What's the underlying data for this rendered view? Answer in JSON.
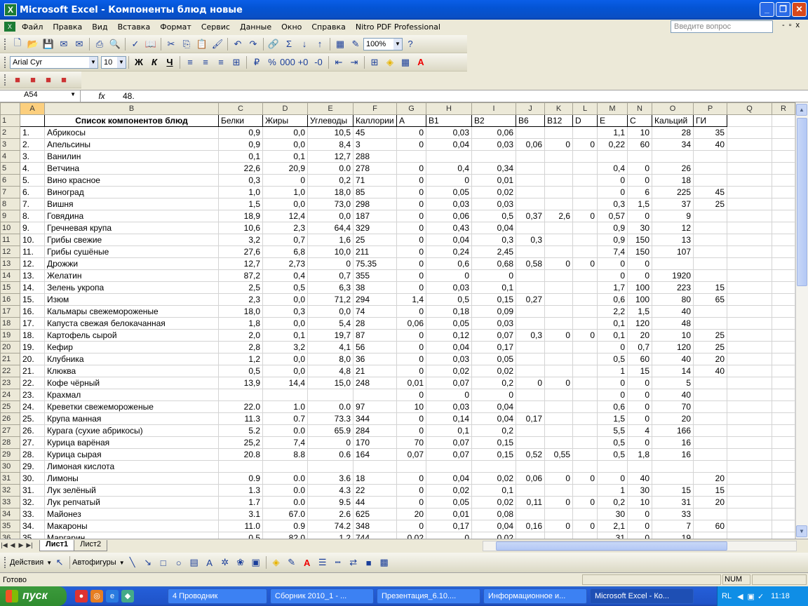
{
  "app": {
    "title": "Microsoft Excel - Компоненты блюд новые"
  },
  "menu": {
    "items": [
      "Файл",
      "Правка",
      "Вид",
      "Вставка",
      "Формат",
      "Сервис",
      "Данные",
      "Окно",
      "Справка",
      "Nitro PDF Professional"
    ],
    "help_placeholder": "Введите вопрос"
  },
  "toolbar": {
    "zoom": "100%",
    "font": "Arial Cyr",
    "size": "10",
    "bold": "Ж",
    "italic": "К",
    "underline": "Ч"
  },
  "formula": {
    "cell": "A54",
    "fx": "fx",
    "value": "48."
  },
  "columns": [
    "A",
    "B",
    "C",
    "D",
    "E",
    "F",
    "G",
    "H",
    "I",
    "J",
    "K",
    "L",
    "M",
    "N",
    "O",
    "P",
    "Q",
    "R"
  ],
  "header": [
    "",
    "Список компонентов блюд",
    "Белки",
    "Жиры",
    "Углеводы",
    "Каллории",
    "A",
    "B1",
    "B2",
    "B6",
    "B12",
    "D",
    "E",
    "C",
    "Кальций",
    "ГИ"
  ],
  "rows": [
    [
      "1.",
      "Абрикосы",
      "0,9",
      "0,0",
      "10,5",
      "45",
      "0",
      "0,03",
      "0,06",
      "",
      "",
      "",
      "1,1",
      "10",
      "28",
      "35"
    ],
    [
      "2.",
      "Апельсины",
      "0,9",
      "0,0",
      "8,4",
      "3",
      "0",
      "0,04",
      "0,03",
      "0,06",
      "0",
      "0",
      "0,22",
      "60",
      "34",
      "40"
    ],
    [
      "3.",
      "Ванилин",
      "0,1",
      "0,1",
      "12,7",
      "288",
      "",
      "",
      "",
      "",
      "",
      "",
      "",
      "",
      "",
      ""
    ],
    [
      "4.",
      "Ветчина",
      "22,6",
      "20,9",
      "0.0",
      "278",
      "0",
      "0,4",
      "0,34",
      "",
      "",
      "",
      "0,4",
      "0",
      "26",
      ""
    ],
    [
      "5.",
      "Вино красное",
      "0,3",
      "0",
      "0,2",
      "71",
      "0",
      "0",
      "0,01",
      "",
      "",
      "",
      "0",
      "0",
      "18",
      ""
    ],
    [
      "6.",
      "Виноград",
      "1,0",
      "1,0",
      "18,0",
      "85",
      "0",
      "0,05",
      "0,02",
      "",
      "",
      "",
      "0",
      "6",
      "225",
      "45"
    ],
    [
      "7.",
      "Вишня",
      "1,5",
      "0,0",
      "73,0",
      "298",
      "0",
      "0,03",
      "0,03",
      "",
      "",
      "",
      "0,3",
      "1,5",
      "37",
      "25"
    ],
    [
      "8.",
      "Говядина",
      "18,9",
      "12,4",
      "0,0",
      "187",
      "0",
      "0,06",
      "0,5",
      "0,37",
      "2,6",
      "0",
      "0,57",
      "0",
      "9",
      ""
    ],
    [
      "9.",
      "Гречневая крупа",
      "10,6",
      "2,3",
      "64,4",
      "329",
      "0",
      "0,43",
      "0,04",
      "",
      "",
      "",
      "0,9",
      "30",
      "12",
      ""
    ],
    [
      "10.",
      "Грибы свежие",
      "3,2",
      "0,7",
      "1,6",
      "25",
      "0",
      "0,04",
      "0,3",
      "0,3",
      "",
      "",
      "0,9",
      "150",
      "13",
      ""
    ],
    [
      "11.",
      "Грибы сушёные",
      "27,6",
      "6,8",
      "10,0",
      "211",
      "0",
      "0,24",
      "2,45",
      "",
      "",
      "",
      "7,4",
      "150",
      "107",
      ""
    ],
    [
      "12.",
      "Дрожжи",
      "12,7",
      "2,73",
      "0",
      "75.35",
      "0",
      "0,6",
      "0,68",
      "0,58",
      "0",
      "0",
      "0",
      "0",
      "",
      ""
    ],
    [
      "13.",
      "Желатин",
      "87,2",
      "0,4",
      "0,7",
      "355",
      "0",
      "0",
      "0",
      "",
      "",
      "",
      "0",
      "0",
      "1920",
      ""
    ],
    [
      "14.",
      "Зелень укропа",
      "2,5",
      "0,5",
      "6,3",
      "38",
      "0",
      "0,03",
      "0,1",
      "",
      "",
      "",
      "1,7",
      "100",
      "223",
      "15"
    ],
    [
      "15.",
      "Изюм",
      "2,3",
      "0,0",
      "71,2",
      "294",
      "1,4",
      "0,5",
      "0,15",
      "0,27",
      "",
      "",
      "0,6",
      "100",
      "80",
      "65"
    ],
    [
      "16.",
      "Кальмары свежемороженые",
      "18,0",
      "0,3",
      "0,0",
      "74",
      "0",
      "0,18",
      "0,09",
      "",
      "",
      "",
      "2,2",
      "1,5",
      "40",
      ""
    ],
    [
      "17.",
      "Капуста свежая белокачанная",
      "1,8",
      "0,0",
      "5,4",
      "28",
      "0,06",
      "0,05",
      "0,03",
      "",
      "",
      "",
      "0,1",
      "120",
      "48",
      ""
    ],
    [
      "18.",
      "Картофель сырой",
      "2,0",
      "0,1",
      "19,7",
      "87",
      "0",
      "0,12",
      "0,07",
      "0,3",
      "0",
      "0",
      "0,1",
      "20",
      "10",
      "25"
    ],
    [
      "19.",
      "Кефир",
      "2,8",
      "3,2",
      "4,1",
      "56",
      "0",
      "0,04",
      "0,17",
      "",
      "",
      "",
      "0",
      "0,7",
      "120",
      "25"
    ],
    [
      "20.",
      "Клубника",
      "1,2",
      "0,0",
      "8,0",
      "36",
      "0",
      "0,03",
      "0,05",
      "",
      "",
      "",
      "0,5",
      "60",
      "40",
      "20"
    ],
    [
      "21.",
      "Клюква",
      "0,5",
      "0,0",
      "4,8",
      "21",
      "0",
      "0,02",
      "0,02",
      "",
      "",
      "",
      "1",
      "15",
      "14",
      "40"
    ],
    [
      "22.",
      "Кофе чёрный",
      "13,9",
      "14,4",
      "15,0",
      "248",
      "0,01",
      "0,07",
      "0,2",
      "0",
      "0",
      "",
      "0",
      "0",
      "5",
      ""
    ],
    [
      "23.",
      "Крахмал",
      "",
      "",
      "",
      "",
      "0",
      "0",
      "0",
      "",
      "",
      "",
      "0",
      "0",
      "40",
      ""
    ],
    [
      "24.",
      "Креветки свежемороженые",
      "22.0",
      "1.0",
      "0.0",
      "97",
      "10",
      "0,03",
      "0,04",
      "",
      "",
      "",
      "0,6",
      "0",
      "70",
      ""
    ],
    [
      "25.",
      "Крупа манная",
      "11.3",
      "0.7",
      "73.3",
      "344",
      "0",
      "0,14",
      "0,04",
      "0,17",
      "",
      "",
      "1,5",
      "0",
      "20",
      ""
    ],
    [
      "26.",
      "Курага (сухие абрикосы)",
      "5.2",
      "0.0",
      "65.9",
      "284",
      "0",
      "0,1",
      "0,2",
      "",
      "",
      "",
      "5,5",
      "4",
      "166",
      ""
    ],
    [
      "27.",
      "Курица варёная",
      "25,2",
      "7,4",
      "0",
      "170",
      "70",
      "0,07",
      "0,15",
      "",
      "",
      "",
      "0,5",
      "0",
      "16",
      ""
    ],
    [
      "28.",
      "Курица сырая",
      "20.8",
      "8.8",
      "0.6",
      "164",
      "0,07",
      "0,07",
      "0,15",
      "0,52",
      "0,55",
      "",
      "0,5",
      "1,8",
      "16",
      ""
    ],
    [
      "29.",
      "Лимоная кислота",
      "",
      "",
      "",
      "",
      "",
      "",
      "",
      "",
      "",
      "",
      "",
      "",
      "",
      ""
    ],
    [
      "30.",
      "Лимоны",
      "0.9",
      "0.0",
      "3.6",
      "18",
      "0",
      "0,04",
      "0,02",
      "0,06",
      "0",
      "0",
      "0",
      "40",
      "",
      "20"
    ],
    [
      "31.",
      "Лук зелёный",
      "1.3",
      "0.0",
      "4.3",
      "22",
      "0",
      "0,02",
      "0,1",
      "",
      "",
      "",
      "1",
      "30",
      "15",
      "15"
    ],
    [
      "32.",
      "Лук репчатый",
      "1.7",
      "0.0",
      "9.5",
      "44",
      "0",
      "0,05",
      "0,02",
      "0,11",
      "0",
      "0",
      "0,2",
      "10",
      "31",
      "20"
    ],
    [
      "33.",
      "Майонез",
      "3.1",
      "67.0",
      "2.6",
      "625",
      "20",
      "0,01",
      "0,08",
      "",
      "",
      "",
      "30",
      "0",
      "33",
      ""
    ],
    [
      "34.",
      "Макароны",
      "11.0",
      "0.9",
      "74.2",
      "348",
      "0",
      "0,17",
      "0,04",
      "0,16",
      "0",
      "0",
      "2,1",
      "0",
      "7",
      "60"
    ],
    [
      "35.",
      "Маргарин",
      "0,5",
      "82,0",
      "1,2",
      "744",
      "0,02",
      "0",
      "0,02",
      "",
      "",
      "",
      "31",
      "0",
      "19",
      ""
    ]
  ],
  "sheets": [
    "Лист1",
    "Лист2"
  ],
  "draw": {
    "actions": "Действия",
    "autoshapes": "Автофигуры"
  },
  "status": {
    "ready": "Готово",
    "num": "NUM"
  },
  "taskbar": {
    "start": "пуск",
    "buttons": [
      "4 Проводник",
      "Сборник 2010_1 - ...",
      "Презентация_6.10....",
      "Информационное и...",
      "Microsoft Excel - Ко..."
    ],
    "lang": "RL",
    "time": "11:18"
  }
}
